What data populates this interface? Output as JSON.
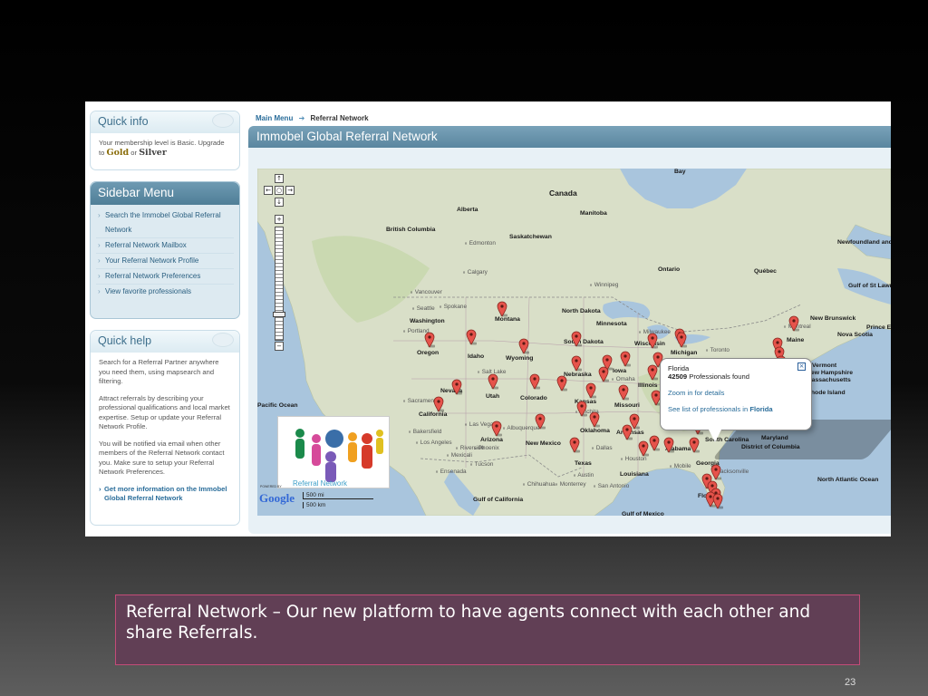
{
  "quick_info": {
    "title": "Quick info",
    "text": "Your membership level is Basic. Upgrade to",
    "gold": "Gold",
    "or": "or",
    "silver": "Silver"
  },
  "sidebar_menu": {
    "title": "Sidebar Menu",
    "items": [
      "Search the Immobel Global Referral Network",
      "Referral Network Mailbox",
      "Your Referral Network Profile",
      "Referral Network Preferences",
      "View favorite professionals"
    ]
  },
  "quick_help": {
    "title": "Quick help",
    "paragraphs": [
      "Search for a Referral Partner anywhere you need them, using mapsearch and filtering.",
      "Attract referrals by describing your professional qualifications and local market expertise. Setup or update your Referral Network Profile.",
      "You will be notified via email when other members of the Referral Network contact you. Make sure to setup your Referral Network Preferences."
    ],
    "link": "Get more information on the Immobel Global Referral Network"
  },
  "breadcrumb": {
    "main": "Main Menu",
    "current": "Referral Network"
  },
  "main_title": "Immobel Global Referral Network",
  "map": {
    "map_labels": [
      "Canada",
      "Alberta",
      "Manitoba",
      "British Columbia",
      "Saskatchewan",
      "Ontario",
      "Québec",
      "Newfoundland and Labrador",
      "Gulf of St Lawrence",
      "North Dakota",
      "Montana",
      "Washington",
      "Minnesota",
      "Oregon",
      "Idaho",
      "Wyoming",
      "South Dakota",
      "Wisconsin",
      "Michigan",
      "Nebraska",
      "Iowa",
      "Illinois",
      "Nevada",
      "Utah",
      "Colorado",
      "Kansas",
      "Missouri",
      "California",
      "Arizona",
      "New Mexico",
      "Oklahoma",
      "Arkansas",
      "Texas",
      "Louisiana",
      "Georgia",
      "Alabama",
      "South Carolina",
      "Florida",
      "Maine",
      "New Brunswick",
      "Nova Scotia",
      "Prince Edward Island",
      "Vermont",
      "New Hampshire",
      "Massachusetts",
      "Rhode Island",
      "Maryland",
      "District of Columbia",
      "Pacific Ocean",
      "North Atlantic Ocean",
      "Gulf of California",
      "Gulf of Mexico",
      "Bay"
    ],
    "city_labels": [
      "Edmonton",
      "Calgary",
      "Vancouver",
      "Seattle",
      "Spokane",
      "Portland",
      "Winnipeg",
      "Salt Lake",
      "Sacramento",
      "Las Vegas",
      "Los Angeles",
      "Albuquerque",
      "Phoenix",
      "Dallas",
      "Houston",
      "Austin",
      "San Antonio",
      "Omaha",
      "Wichita",
      "Jacksonville",
      "Toronto",
      "Montreal",
      "Chihuahua",
      "Monterrey",
      "Mobile",
      "Bakersfield",
      "Tucson",
      "Milwaukee",
      "Riverside",
      "Mexicali",
      "Ensenada"
    ],
    "scale": {
      "mi": "500 mi",
      "km": "500 km"
    },
    "google": {
      "powered_by": "POWERED BY",
      "name": "Google"
    },
    "logo_text": "Referral Network",
    "pin_color": "#e6534b",
    "pin_count": 44
  },
  "popup": {
    "place": "Florida",
    "count": "42509",
    "count_label": "Professionals found",
    "zoom_link": "Zoom in for details",
    "list_link_prefix": "See list of professionals in",
    "list_link_place": "Florida"
  },
  "caption": "Referral Network – Our new platform to have agents connect with each other and share Referrals.",
  "slide_number": "23",
  "colors": {
    "caption_bg": "#613f55",
    "caption_border": "#c34c78",
    "header_blue": "#5a869f"
  }
}
